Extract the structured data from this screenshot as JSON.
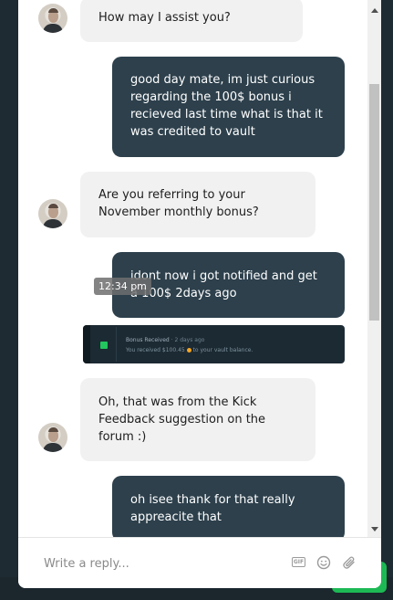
{
  "messages": [
    {
      "from": "agent",
      "text": "How may I assist you?"
    },
    {
      "from": "user",
      "text": "good day mate, im just curious regarding the 100$ bonus i recieved last time what is that it was credited to vault"
    },
    {
      "from": "agent",
      "text": "Are you referring to your November monthly bonus?"
    },
    {
      "from": "user",
      "text": "idont now i got notified and get a 100$ 2days ago",
      "time": "12:34 pm"
    },
    {
      "from": "user",
      "type": "image",
      "image": {
        "title": "Bonus Received",
        "subtitle": "· 2 days ago",
        "line_prefix": "You received $100.45",
        "line_suffix": "to your vault balance."
      }
    },
    {
      "from": "agent",
      "text": "Oh, that was from the Kick Feedback suggestion on the forum :)"
    },
    {
      "from": "user",
      "text": "oh isee thank for that really appreacite that"
    }
  ],
  "composer": {
    "placeholder": "Write a reply...",
    "gif_label": "GIF"
  },
  "icons": {
    "gif": "gif-icon",
    "emoji": "emoji-icon",
    "attachment": "paperclip-icon",
    "scroll_up": "scroll-up-arrow",
    "scroll_down": "scroll-down-arrow",
    "image_badge": "gift-icon"
  },
  "colors": {
    "user_bubble": "#2d404c",
    "agent_bubble": "#f1f1f1",
    "accent_green": "#1db954"
  }
}
